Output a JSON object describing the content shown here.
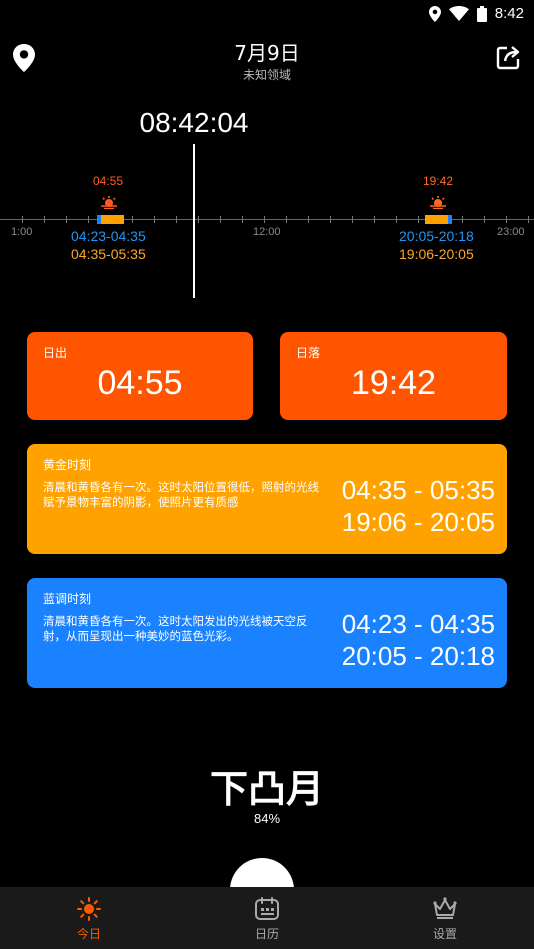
{
  "status_bar": {
    "time": "8:42"
  },
  "header": {
    "date": "7月9日",
    "location": "未知领域"
  },
  "timeline": {
    "current_time": "08:42:04",
    "sunrise": {
      "time": "04:55",
      "blue_hour": "04:23-04:35",
      "golden_hour": "04:35-05:35"
    },
    "sunset": {
      "time": "19:42",
      "blue_hour": "20:05-20:18",
      "golden_hour": "19:06-20:05"
    },
    "axis_labels": [
      "1:00",
      "12:00",
      "23:00"
    ]
  },
  "cards": {
    "sunrise": {
      "title": "日出",
      "value": "04:55"
    },
    "sunset": {
      "title": "日落",
      "value": "19:42"
    },
    "golden": {
      "title": "黄金时刻",
      "description": "清晨和黄昏各有一次。这时太阳位置很低，照射的光线赋予景物丰富的阴影，使照片更有质感",
      "times": [
        "04:35 - 05:35",
        "19:06 - 20:05"
      ]
    },
    "blue": {
      "title": "蓝调时刻",
      "description": "清晨和黄昏各有一次。这时太阳发出的光线被天空反射，从而呈现出一种美妙的蓝色光彩。",
      "times": [
        "04:23 - 04:35",
        "20:05 - 20:18"
      ]
    }
  },
  "moon": {
    "phase": "下凸月",
    "illumination": "84%"
  },
  "nav": [
    {
      "label": "今日",
      "icon": "sun-icon",
      "active": true
    },
    {
      "label": "日历",
      "icon": "calendar-icon",
      "active": false
    },
    {
      "label": "设置",
      "icon": "crown-icon",
      "active": false
    }
  ],
  "colors": {
    "sun_orange": "#ff5500",
    "golden": "#ffa200",
    "blue": "#1a82ff",
    "sunrise_text": "#ff5a1f",
    "sunset_text": "#ff6a1f"
  }
}
